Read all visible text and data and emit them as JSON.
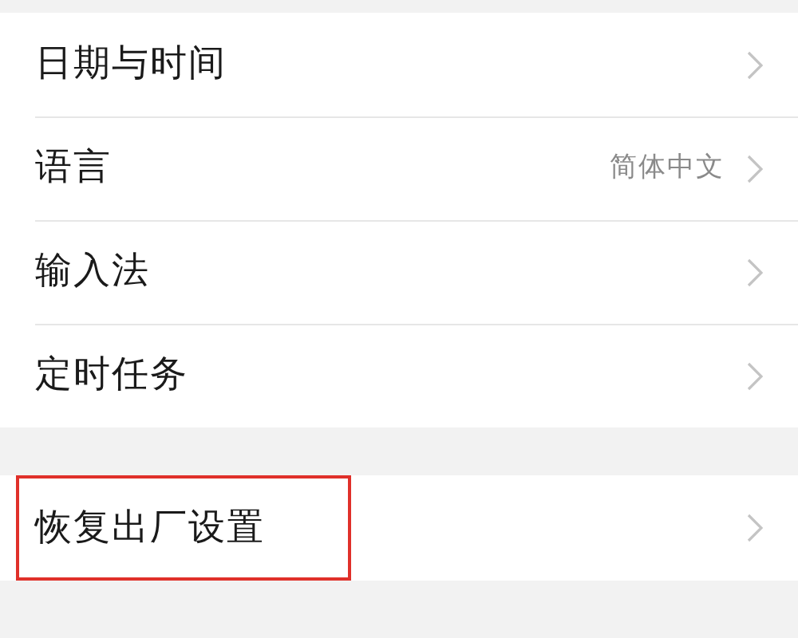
{
  "groups": [
    {
      "items": [
        {
          "label": "日期与时间",
          "highlighted": false
        },
        {
          "label": "语言",
          "value": "简体中文",
          "highlighted": false
        },
        {
          "label": "输入法",
          "highlighted": false
        },
        {
          "label": "定时任务",
          "highlighted": false
        }
      ]
    },
    {
      "items": [
        {
          "label": "恢复出厂设置",
          "highlighted": true
        }
      ]
    }
  ]
}
